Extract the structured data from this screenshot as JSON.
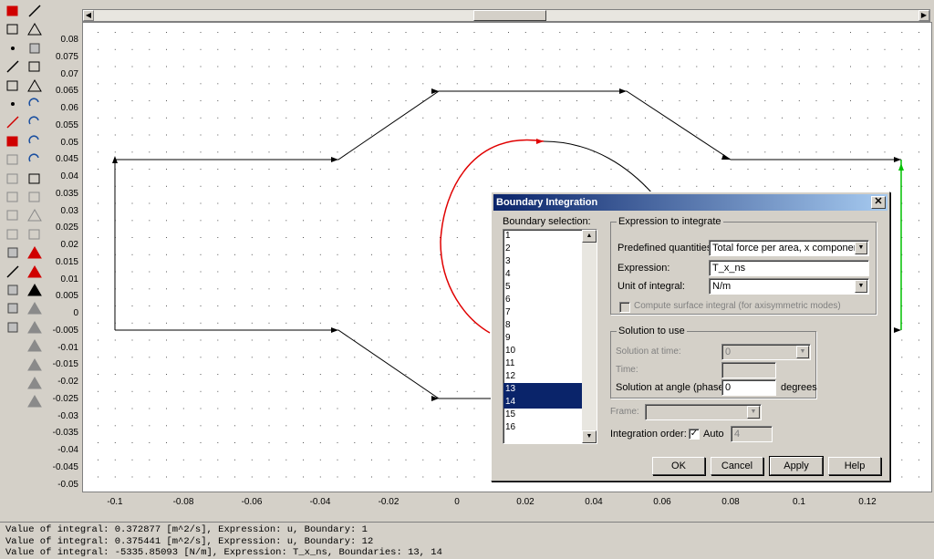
{
  "plot": {
    "y_ticks": [
      "0.08",
      "0.075",
      "0.07",
      "0.065",
      "0.06",
      "0.055",
      "0.05",
      "0.045",
      "0.04",
      "0.035",
      "0.03",
      "0.025",
      "0.02",
      "0.015",
      "0.01",
      "0.005",
      "0",
      "-0.005",
      "-0.01",
      "-0.015",
      "-0.02",
      "-0.025",
      "-0.03",
      "-0.035",
      "-0.04",
      "-0.045",
      "-0.05"
    ],
    "x_ticks": [
      "-0.1",
      "-0.08",
      "-0.06",
      "-0.04",
      "-0.02",
      "0",
      "0.02",
      "0.04",
      "0.06",
      "0.08",
      "0.1",
      "0.12"
    ]
  },
  "toolbar": {
    "left_icons": [
      "draw-mode-icon",
      "select-icon",
      "point-icon",
      "line-icon",
      "rectangle-icon",
      "small-point-icon",
      "red-line-icon",
      "red-square-icon",
      "mesh-icon",
      "mesh-edit-icon",
      "mesh-refine-icon",
      "mesh-all-icon",
      "mesh-mode-icon",
      "boundary-icon",
      "edge-icon",
      "subdomain-icon",
      "settings-icon",
      "tag-icon"
    ],
    "right_icons": [
      "arrow-icon",
      "triangle-icon",
      "polygon-icon",
      "square-icon",
      "cone-icon",
      "rotate-icon",
      "rotate2-icon",
      "rotate3-icon",
      "rotate4-icon",
      "mesh-init-icon",
      "mesh-refine2-icon",
      "mesh-triangle-icon",
      "mesh-remove-icon",
      "solve-icon",
      "solve2-icon",
      "plot-icon",
      "plot2-icon",
      "plot3-icon",
      "plot4-icon",
      "plot5-icon",
      "plot6-icon",
      "plot7-icon"
    ]
  },
  "dialog": {
    "title": "Boundary Integration",
    "close_glyph": "✕",
    "boundary_selection_label": "Boundary selection:",
    "boundaries": [
      {
        "label": "1",
        "selected": false
      },
      {
        "label": "2",
        "selected": false
      },
      {
        "label": "3",
        "selected": false
      },
      {
        "label": "4",
        "selected": false
      },
      {
        "label": "5",
        "selected": false
      },
      {
        "label": "6",
        "selected": false
      },
      {
        "label": "7",
        "selected": false
      },
      {
        "label": "8",
        "selected": false
      },
      {
        "label": "9",
        "selected": false
      },
      {
        "label": "10",
        "selected": false
      },
      {
        "label": "11",
        "selected": false
      },
      {
        "label": "12",
        "selected": false
      },
      {
        "label": "13",
        "selected": true
      },
      {
        "label": "14",
        "selected": true
      },
      {
        "label": "15",
        "selected": false
      },
      {
        "label": "16",
        "selected": false
      }
    ],
    "expr_group_title": "Expression to integrate",
    "predefined_label": "Predefined quantities:",
    "predefined_value": "Total force per area, x component",
    "expression_label": "Expression:",
    "expression_value": "T_x_ns",
    "unit_label": "Unit of integral:",
    "unit_value": "N/m",
    "surface_integral_label": "Compute surface integral (for axisymmetric modes)",
    "solution_group_title": "Solution to use",
    "solution_time_label": "Solution at time:",
    "solution_time_value": "0",
    "time_label": "Time:",
    "time_value": "",
    "angle_label": "Solution at angle (phase):",
    "angle_value": "0",
    "angle_unit": "degrees",
    "frame_label": "Frame:",
    "frame_value": "",
    "integration_order_label": "Integration order:",
    "auto_label": "Auto",
    "auto_checked": "✓",
    "integration_order_value": "4",
    "ok_label": "OK",
    "cancel_label": "Cancel",
    "apply_label": "Apply",
    "help_label": "Help"
  },
  "status": {
    "lines": [
      "Value of integral: 0.372877 [m^2/s], Expression: u, Boundary: 1",
      "Value of integral: 0.375441 [m^2/s], Expression: u, Boundary: 12",
      "Value of integral: -5335.85093 [N/m], Expression: T_x_ns, Boundaries: 13, 14"
    ]
  },
  "colors": {
    "selection": "#0a246a",
    "highlight_curve": "#e00000",
    "highlight_edge": "#00c000",
    "geometry": "#000000"
  }
}
